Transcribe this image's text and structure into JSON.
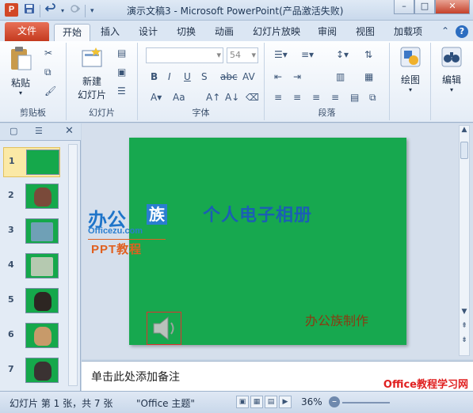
{
  "titlebar": {
    "app_icon_letter": "P",
    "title": "演示文稿3  -  Microsoft PowerPoint(产品激活失败)",
    "qat": {
      "save": "save-icon",
      "undo": "undo-icon",
      "redo": "redo-icon"
    },
    "controls": {
      "minimize": "–",
      "maximize": "□",
      "close": "✕"
    }
  },
  "tabs": {
    "file": "文件",
    "items": [
      "开始",
      "插入",
      "设计",
      "切换",
      "动画",
      "幻灯片放映",
      "审阅",
      "视图",
      "加载项"
    ],
    "active": "开始",
    "help": "?"
  },
  "ribbon": {
    "clipboard": {
      "paste": "粘贴",
      "label": "剪贴板"
    },
    "slides": {
      "new_slide": "新建\n幻灯片",
      "new_slide_line1": "新建",
      "new_slide_line2": "幻灯片",
      "label": "幻灯片"
    },
    "font": {
      "size": "54",
      "label": "字体",
      "bold": "B",
      "italic": "I",
      "underline": "U",
      "strike": "S",
      "abc": "abc",
      "av": "AV",
      "aa": "Aa"
    },
    "paragraph": {
      "label": "段落"
    },
    "drawing": {
      "label": "绘图"
    },
    "editing": {
      "label": "编辑"
    }
  },
  "slides_panel": {
    "numbers": [
      "1",
      "2",
      "3",
      "4",
      "5",
      "6",
      "7"
    ],
    "selected_index": 0
  },
  "slide": {
    "title": "个人电子相册",
    "credit": "办公族制作",
    "logo": {
      "text": "办公",
      "box": "族",
      "domain": "Officezu.com",
      "ppt": "PPT教程"
    }
  },
  "notes": {
    "placeholder": "单击此处添加备注",
    "watermark": "Office教程学习网"
  },
  "status": {
    "slide_info": "幻灯片 第 1 张，共 7 张",
    "theme": "\"Office 主题\"",
    "zoom": "36%"
  },
  "colors": {
    "slide_bg": "#17a84f",
    "title_blue": "#1b5fb3",
    "file_tab": "#c43a1f",
    "credit": "#8a3b12"
  }
}
